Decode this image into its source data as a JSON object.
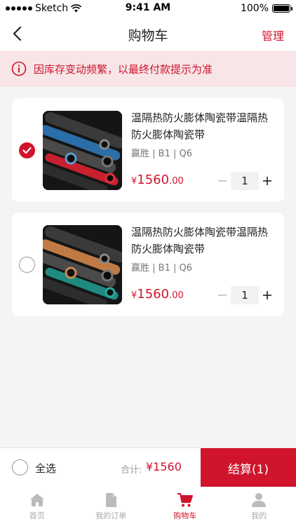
{
  "status_bar": {
    "carrier": "Sketch",
    "time": "9:41 AM",
    "battery": "100%"
  },
  "nav": {
    "title": "购物车",
    "manage": "管理"
  },
  "notice": {
    "text": "因库存变动频繁，以最终付款提示为准"
  },
  "items": [
    {
      "title": "温隔热防火膨体陶瓷带温隔热防火膨体陶瓷带",
      "spec": "赢胜 | B1 | Q6",
      "price_symbol": "¥",
      "price_int": "1560",
      "price_dec": ".00",
      "quantity": "1",
      "checked": true
    },
    {
      "title": "温隔热防火膨体陶瓷带温隔热防火膨体陶瓷带",
      "spec": "赢胜 | B1 | Q6",
      "price_symbol": "¥",
      "price_int": "1560",
      "price_dec": ".00",
      "quantity": "1",
      "checked": false
    }
  ],
  "checkout": {
    "select_all": "全选",
    "total_label": "合计:",
    "total_value": "¥1560",
    "button": "结算(1)"
  },
  "tabs": [
    {
      "label": "首页",
      "icon": "home-icon",
      "active": false
    },
    {
      "label": "我的订单",
      "icon": "document-icon",
      "active": false
    },
    {
      "label": "购物车",
      "icon": "cart-icon",
      "active": true
    },
    {
      "label": "我的",
      "icon": "person-icon",
      "active": false
    }
  ],
  "colors": {
    "accent": "#d0142c",
    "background": "#f4f4f4",
    "notice_bg": "#f7e5e7"
  }
}
